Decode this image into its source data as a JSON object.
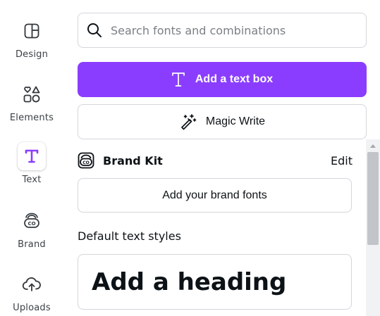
{
  "sidebar": {
    "items": [
      {
        "label": "Design",
        "icon": "design-icon"
      },
      {
        "label": "Elements",
        "icon": "elements-icon"
      },
      {
        "label": "Text",
        "icon": "text-icon",
        "active": true
      },
      {
        "label": "Brand",
        "icon": "brand-icon"
      },
      {
        "label": "Uploads",
        "icon": "uploads-icon"
      }
    ]
  },
  "search": {
    "placeholder": "Search fonts and combinations",
    "value": ""
  },
  "actions": {
    "add_text_box": "Add a text box",
    "magic_write": "Magic Write"
  },
  "brand_kit": {
    "title": "Brand Kit",
    "edit": "Edit",
    "add_fonts": "Add your brand fonts"
  },
  "default_styles": {
    "title": "Default text styles",
    "heading": "Add a heading"
  },
  "colors": {
    "accent": "#8b3dff",
    "active_text_icon": "#8b3dff",
    "border": "#d4d6da",
    "text": "#0d1216"
  }
}
